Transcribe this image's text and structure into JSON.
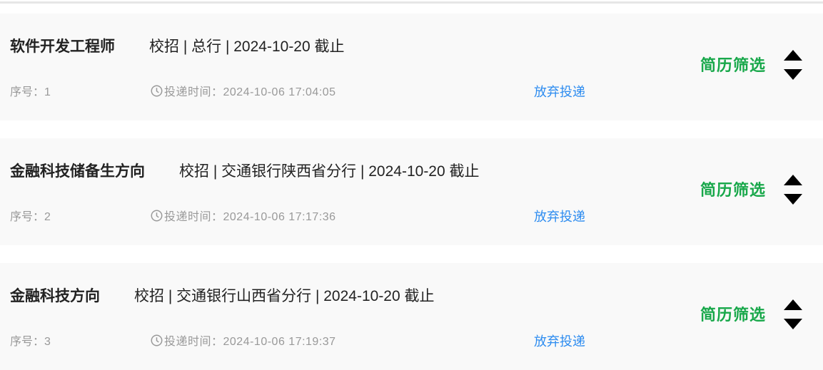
{
  "applications": [
    {
      "title": "软件开发工程师",
      "detail": "校招 | 总行 | 2024-10-20 截止",
      "seq": "序号：1",
      "time": "投递时间：2024-10-06 17:04:05",
      "withdraw": "放弃投递",
      "status": "简历筛选"
    },
    {
      "title": "金融科技储备生方向",
      "detail": "校招 | 交通银行陕西省分行 | 2024-10-20 截止",
      "seq": "序号：2",
      "time": "投递时间：2024-10-06 17:17:36",
      "withdraw": "放弃投递",
      "status": "简历筛选"
    },
    {
      "title": "金融科技方向",
      "detail": "校招 | 交通银行山西省分行 | 2024-10-20 截止",
      "seq": "序号：3",
      "time": "投递时间：2024-10-06 17:19:37",
      "withdraw": "放弃投递",
      "status": "简历筛选"
    }
  ]
}
